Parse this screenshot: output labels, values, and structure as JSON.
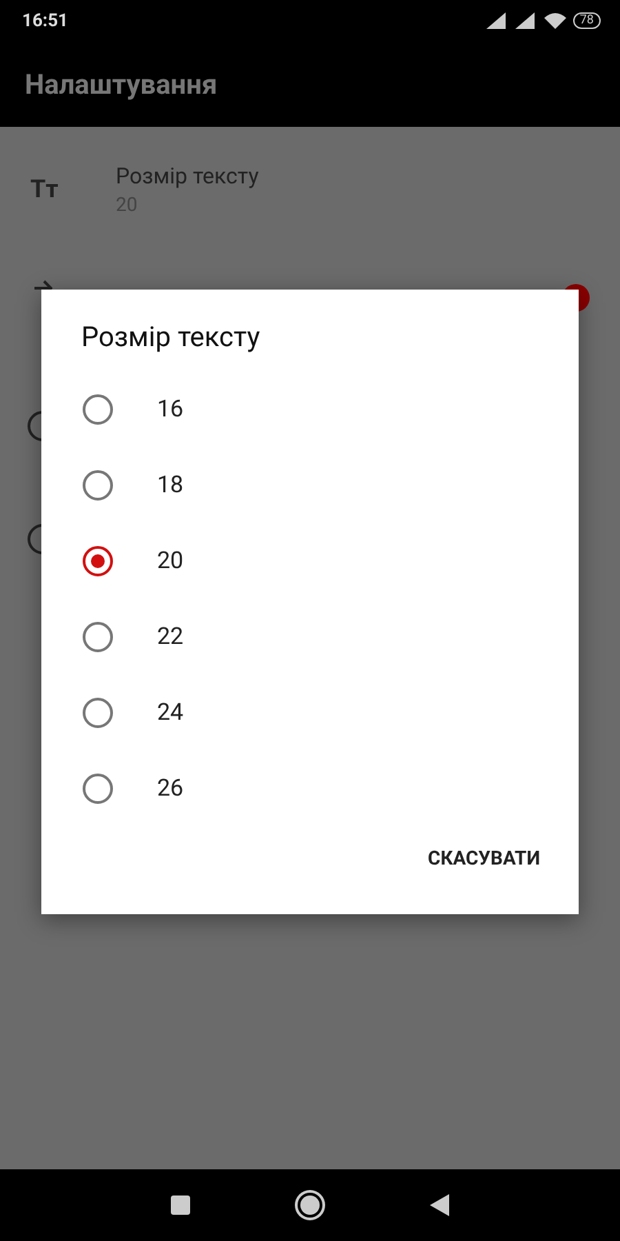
{
  "status_bar": {
    "time": "16:51",
    "battery": "78"
  },
  "app_bar": {
    "title": "Налаштування"
  },
  "settings": [
    {
      "kind": "value",
      "icon_text": "Tт",
      "title": "Розмір тексту",
      "value": "20"
    },
    {
      "kind": "toggle",
      "on": true
    },
    {
      "kind": "radio"
    },
    {
      "kind": "radio"
    }
  ],
  "dialog": {
    "title": "Розмір тексту",
    "options": [
      {
        "label": "16",
        "selected": false
      },
      {
        "label": "18",
        "selected": false
      },
      {
        "label": "20",
        "selected": true
      },
      {
        "label": "22",
        "selected": false
      },
      {
        "label": "24",
        "selected": false
      },
      {
        "label": "26",
        "selected": false
      }
    ],
    "buttons": [
      "СКАСУВАТИ"
    ]
  }
}
